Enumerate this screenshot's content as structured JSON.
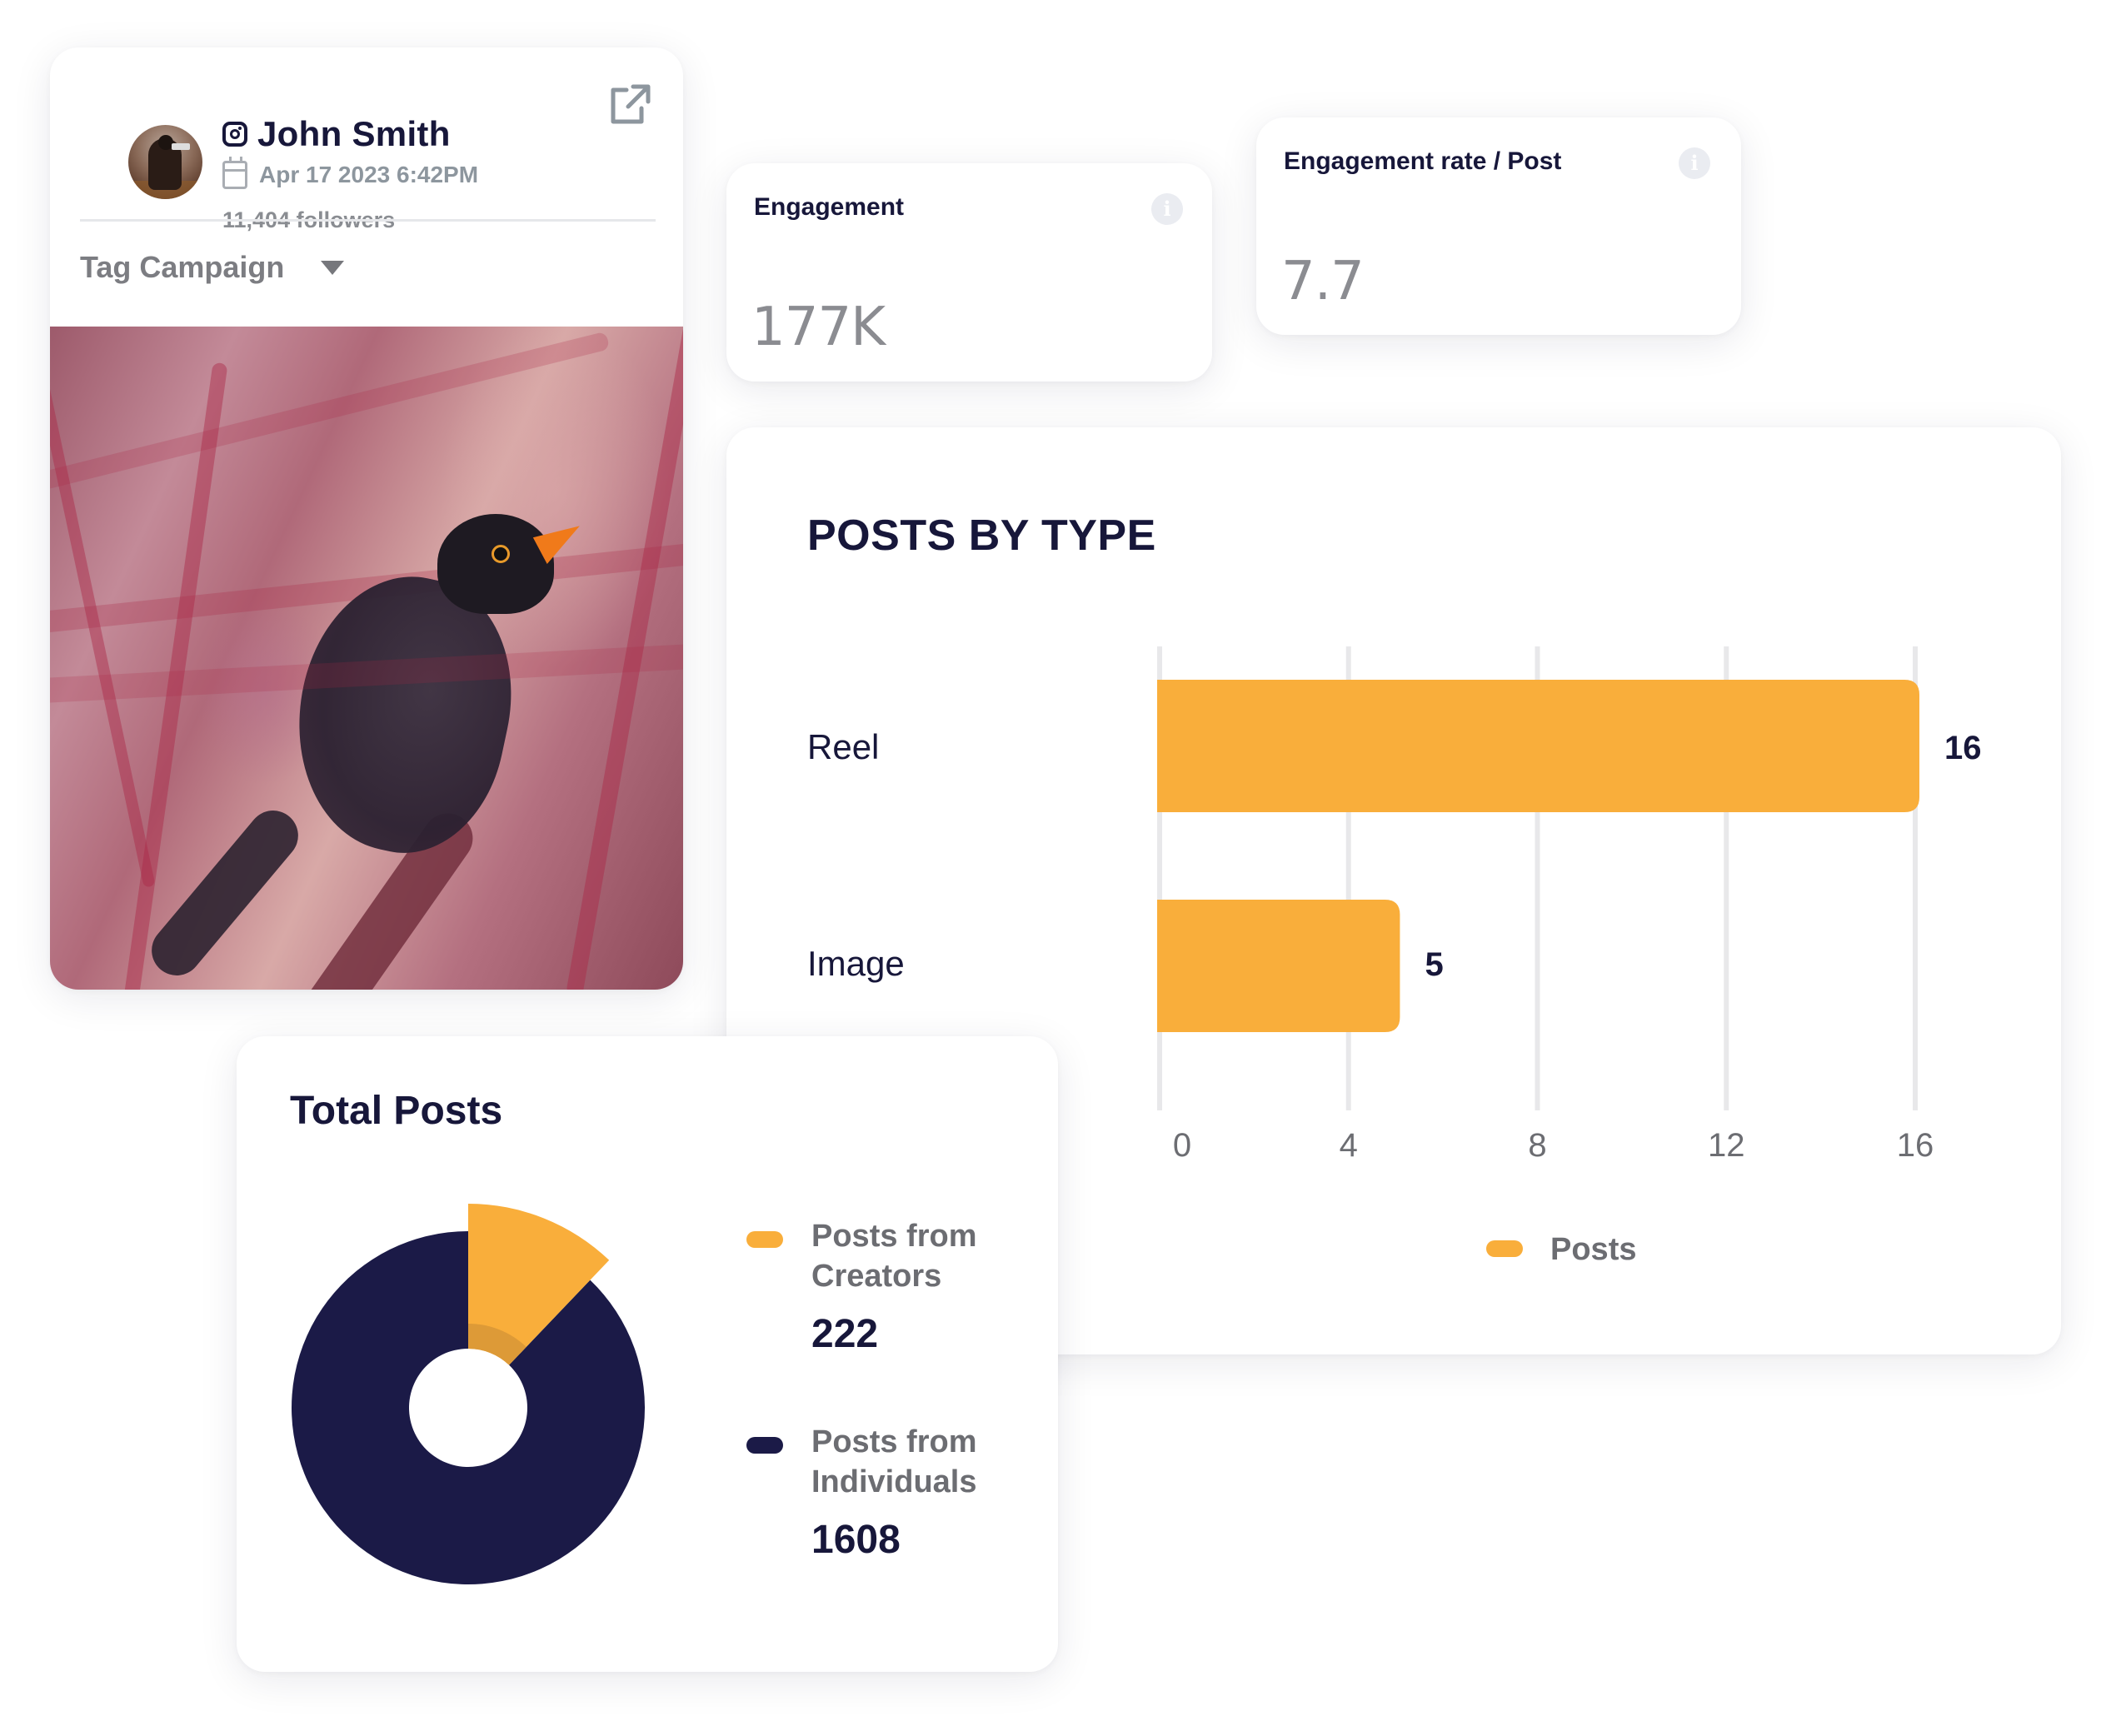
{
  "profile": {
    "name": "John Smith",
    "platform_icon": "instagram-icon",
    "date": "Apr 17 2023 6:42PM",
    "followers": "11,404 followers",
    "tag_campaign_label": "Tag Campaign",
    "post_image_subject": "Blackbird perched among red branches"
  },
  "stats": {
    "engagement": {
      "title": "Engagement",
      "value": "177K"
    },
    "engagement_rate": {
      "title": "Engagement rate / Post",
      "value": "7.7"
    }
  },
  "colors": {
    "accent_orange": "#F9AE3B",
    "navy": "#1B1A47",
    "text_dark": "#17173A",
    "text_muted": "#8B8C91",
    "gridline": "#E8E8EA"
  },
  "chart_data": [
    {
      "type": "bar",
      "orientation": "horizontal",
      "title": "POSTS BY TYPE",
      "categories": [
        "Reel",
        "Image"
      ],
      "series": [
        {
          "name": "Posts",
          "values": [
            16,
            5
          ]
        }
      ],
      "data_labels": [
        "16",
        "5"
      ],
      "xlabel": "",
      "ylabel": "",
      "xlim": [
        0,
        16
      ],
      "x_ticks": [
        "0",
        "4",
        "8",
        "12",
        "16"
      ],
      "x_tick_values": [
        0,
        4,
        8,
        12,
        16
      ],
      "grid": true,
      "legend": {
        "placement": "bottom-center",
        "entries": [
          "Posts"
        ]
      }
    },
    {
      "type": "pie",
      "variant": "donut",
      "title": "Total Posts",
      "categories": [
        "Posts from Creators",
        "Posts from Individuals"
      ],
      "values": [
        222,
        1608
      ],
      "display_values": [
        "222",
        "1608"
      ],
      "legend": {
        "placement": "right",
        "entries": [
          "Posts from Creators",
          "Posts from Individuals"
        ]
      }
    }
  ]
}
